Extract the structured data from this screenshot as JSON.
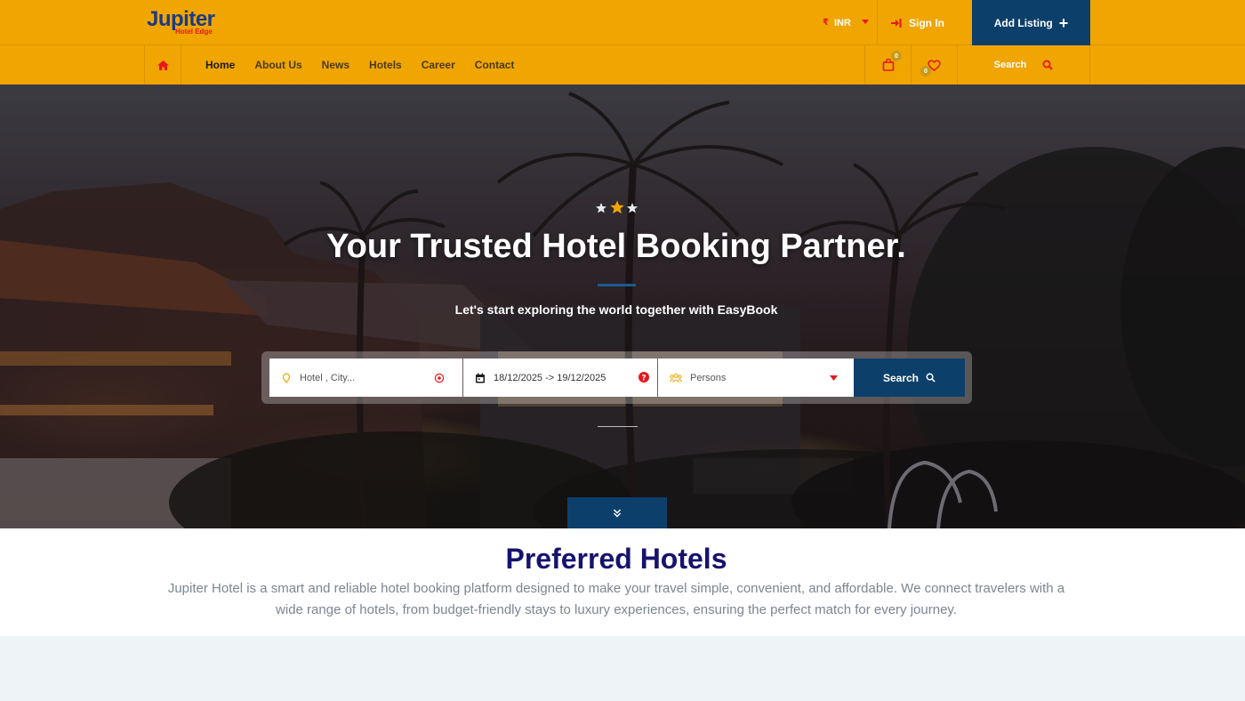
{
  "brand": {
    "name": "Jupiter",
    "tagline": "Hotel Edge"
  },
  "topbar": {
    "currency": "INR",
    "currency_symbol": "₹",
    "signin_label": "Sign In",
    "add_listing_label": "Add Listing"
  },
  "nav": {
    "links": [
      "Home",
      "About Us",
      "News",
      "Hotels",
      "Career",
      "Contact"
    ],
    "active": "Home",
    "cart_count": "0",
    "wishlist_count": "0",
    "search_label": "Search"
  },
  "hero": {
    "rating_stars": 3,
    "title": "Your Trusted Hotel Booking Partner.",
    "subtitle": "Let's start exploring the world together with EasyBook"
  },
  "search": {
    "hotel_placeholder": "Hotel , City...",
    "date_value": "18/12/2025 -> 19/12/2025",
    "persons_placeholder": "Persons",
    "button_label": "Search"
  },
  "preferred": {
    "title": "Preferred Hotels",
    "description": "Jupiter Hotel is a smart and reliable hotel booking platform designed to make your travel simple, convenient, and affordable. We connect travelers with a wide range of hotels, from budget-friendly stays to luxury experiences, ensuring the perfect match for every journey."
  },
  "colors": {
    "header_bg": "#f0a500",
    "primary_dark": "#0d3f6b",
    "accent_red": "#e8171b",
    "title_navy": "#16126e"
  },
  "icons": [
    "home-icon",
    "sign-in-icon",
    "plus-icon",
    "shopping-bag-icon",
    "heart-icon",
    "search-icon",
    "map-pin-icon",
    "location-target-icon",
    "calendar-icon",
    "help-icon",
    "users-icon",
    "chevron-double-down-icon"
  ]
}
